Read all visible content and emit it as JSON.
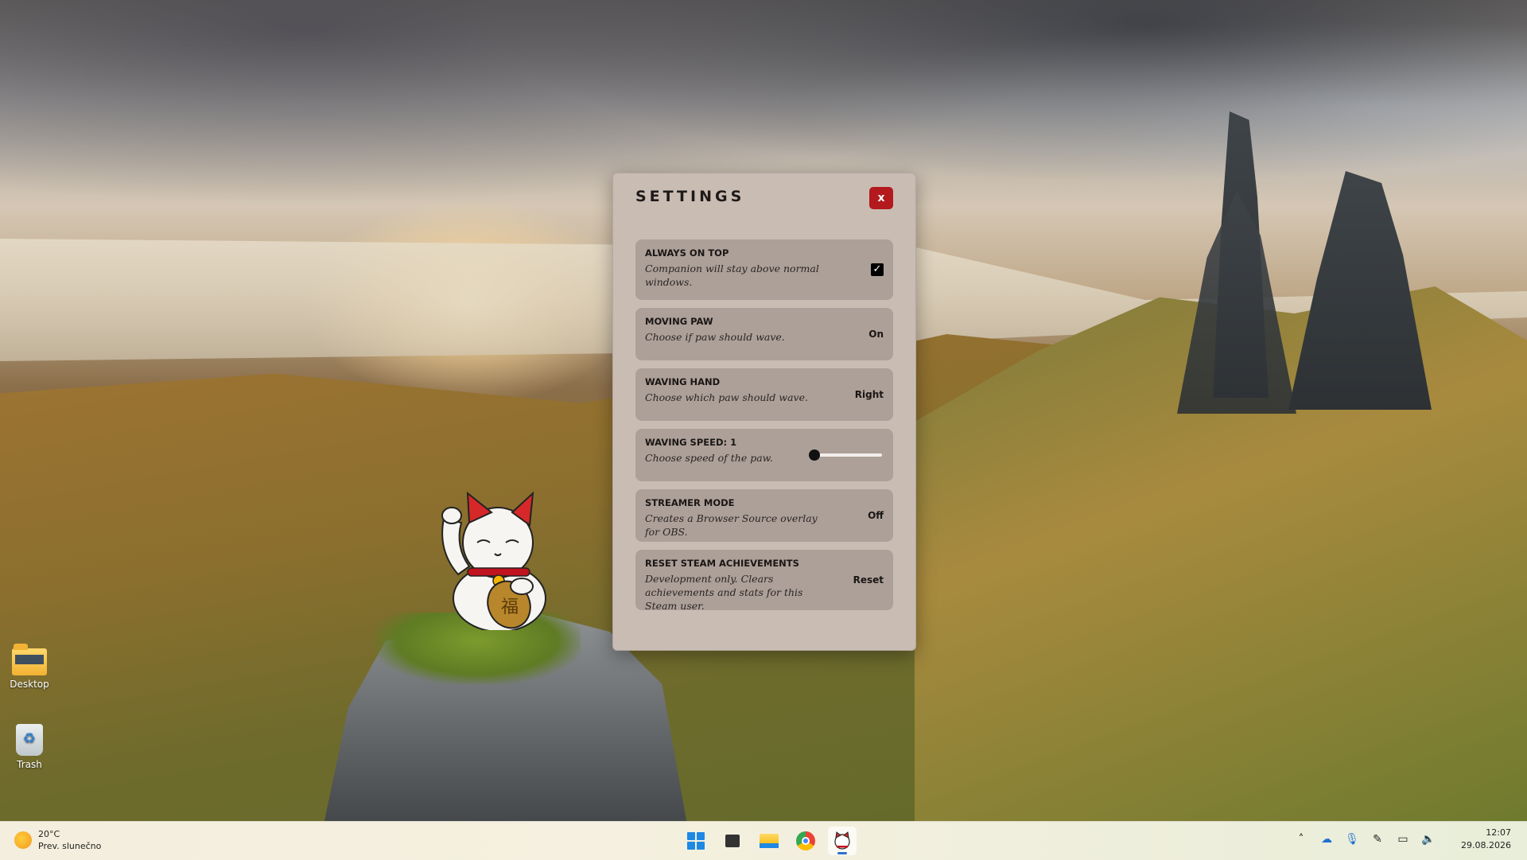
{
  "desktop": {
    "icons": [
      {
        "label": "Desktop"
      },
      {
        "label": "Trash"
      }
    ]
  },
  "settings": {
    "title": "SETTINGS",
    "close_label": "x",
    "rows": [
      {
        "title": "ALWAYS ON TOP",
        "description": "Companion will stay above normal windows.",
        "control": "✓"
      },
      {
        "title": "MOVING PAW",
        "description": "Choose if paw should wave.",
        "control": "On"
      },
      {
        "title": "WAVING HAND",
        "description": "Choose which paw should wave.",
        "control": "Right"
      },
      {
        "title": "WAVING SPEED: 1",
        "description": "Choose speed of the paw.",
        "slider_value": 1,
        "slider_min": 1,
        "slider_max": 10
      },
      {
        "title": "STREAMER MODE",
        "description": "Creates a Browser Source overlay for OBS.",
        "control": "Off"
      },
      {
        "title": "RESET STEAM ACHIEVEMENTS",
        "description": "Development only. Clears achievements and stats for this Steam user.",
        "control": "Reset"
      }
    ]
  },
  "taskbar": {
    "weather": {
      "temp": "20°C",
      "condition": "Prev. slunečno"
    },
    "apps": [
      "start-icon",
      "task-view-icon",
      "file-explorer-icon",
      "chrome-icon",
      "cat-companion-icon"
    ],
    "tray_icons": [
      "chevron-up-icon",
      "onedrive-icon",
      "microphone-icon",
      "pen-icon",
      "network-icon",
      "speaker-icon"
    ],
    "clock": {
      "time": "12:07",
      "date": "29.08.2026"
    }
  },
  "colors": {
    "window_bg": "#c9bcb3",
    "row_bg": "#ada099",
    "close_button": "#b3191d"
  }
}
